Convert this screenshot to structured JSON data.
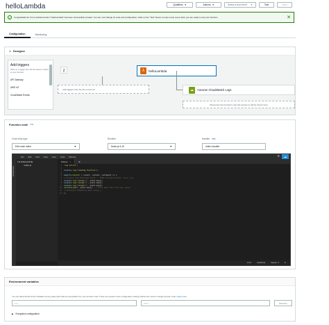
{
  "page_title": "helloLambda",
  "header": {
    "qualifiers_label": "Qualifiers",
    "actions_label": "Actions",
    "test_event_placeholder": "Select a test event",
    "test_label": "Test",
    "save_label": "Save"
  },
  "flash": {
    "message": "Congratulations! Your Lambda function \"helloLambda\" has been successfully created. You can now change its code and configuration. Click on the \"Test\" button to input a test event when you are ready to test your function."
  },
  "tabs": [
    {
      "label": "Configuration",
      "active": true
    },
    {
      "label": "Monitoring",
      "active": false
    }
  ],
  "designer": {
    "title": "Designer",
    "add_triggers_title": "Add triggers",
    "add_triggers_hint": "Click on a trigger from the list below to add it to your function.",
    "triggers": [
      "API Gateway",
      "AWS IoT",
      "CloudWatch Events"
    ],
    "function_name": "helloLambda",
    "add_trigger_hint": "Add triggers from the list on the left",
    "resource_label": "Amazon CloudWatch Logs",
    "resource_hint": "Resources the function's role has access to will be shown here"
  },
  "function_code": {
    "title": "Function code",
    "info": "Info",
    "code_entry_label": "Code entry type",
    "code_entry_value": "Edit code inline",
    "runtime_label": "Runtime",
    "runtime_value": "Node.js 6.10",
    "handler_label": "Handler",
    "handler_info": "Info",
    "handler_value": "index.handler"
  },
  "ide": {
    "menu": [
      "File",
      "Edit",
      "Find",
      "View",
      "Goto",
      "Tools",
      "Window"
    ],
    "environment_label": "Environment",
    "tree": {
      "folder": "helloLambda",
      "file": "index.js"
    },
    "tab_label": "index.js",
    "status_position": "14:11",
    "status_lang": "JavaScript",
    "status_spaces": "Spaces: 4"
  },
  "env_vars": {
    "title": "Environment variables",
    "description": "You can define Environment Variables as key-value pairs that are accessible from your function code. These are useful to store configuration settings without the need to change function code.",
    "learn_more": "Learn more",
    "key_placeholder": "Key",
    "value_placeholder": "Value",
    "remove_label": "Remove",
    "encryption_label": "Encryption configuration"
  },
  "colors": {
    "success": "#1d8102",
    "link": "#0073bb",
    "lambda_orange": "#d86613",
    "cloudwatch_green": "#7aa116"
  }
}
